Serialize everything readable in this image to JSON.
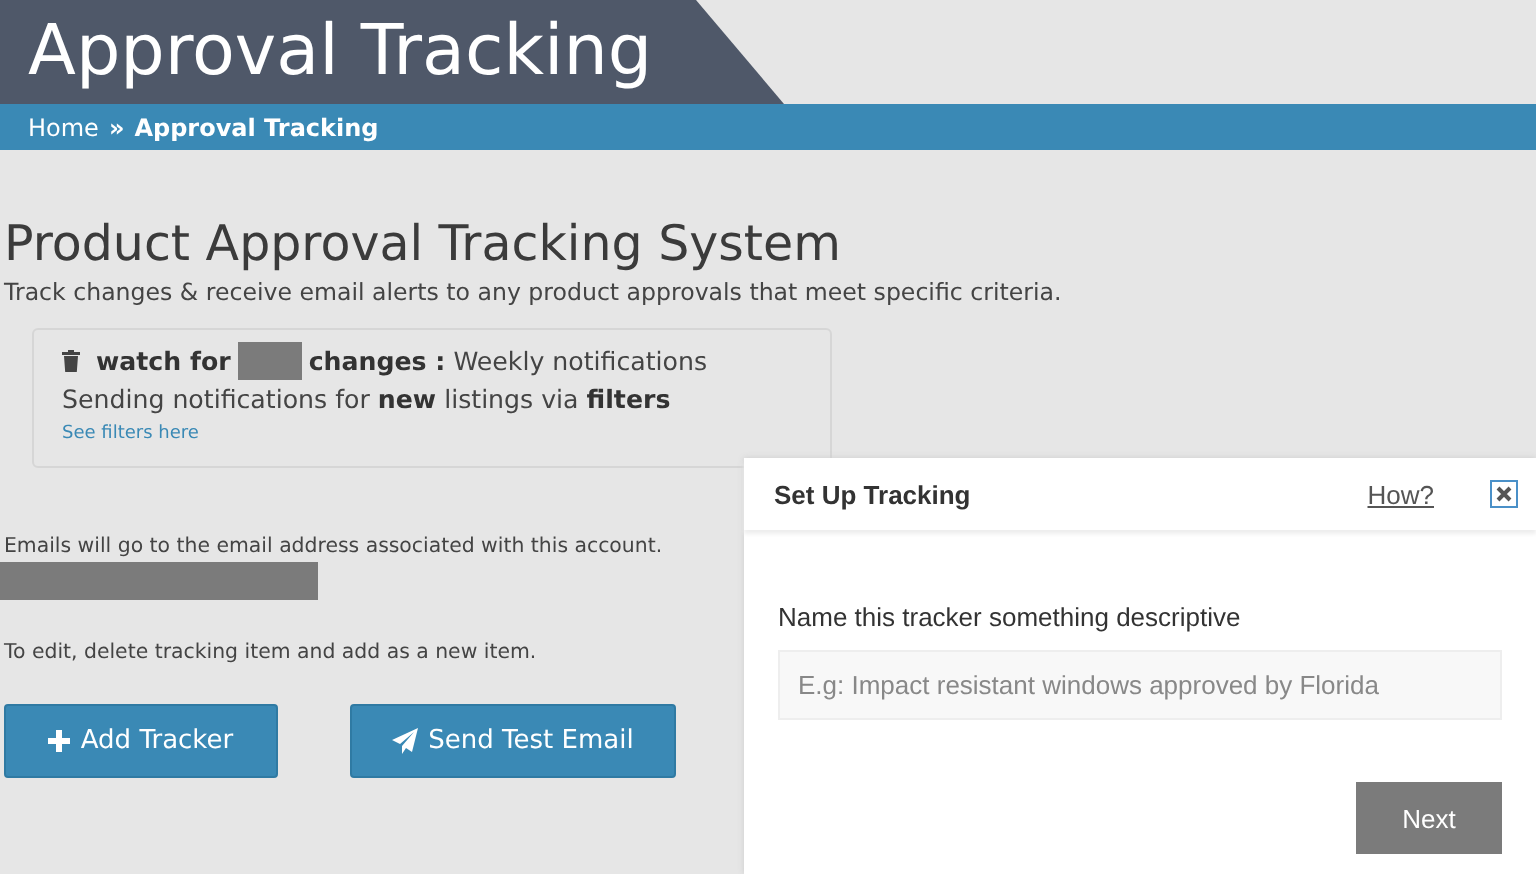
{
  "header": {
    "title": "Approval Tracking"
  },
  "breadcrumb": [
    {
      "label": "Home",
      "current": false
    },
    {
      "label": "»",
      "current": true
    },
    {
      "label": "Approval Tracking",
      "current": true
    }
  ],
  "page": {
    "title": "Product Approval Tracking System",
    "subtitle": "Track changes & receive email alerts to any product approvals that meet specific criteria."
  },
  "tracker": {
    "name_prefix": "watch for",
    "name_suffix": "changes :",
    "frequency": "Weekly notifications",
    "description": "Sending notifications for **new** listings via **filters**",
    "link": "See filters here"
  },
  "email_note": "Emails will go to the email address associated with this account.",
  "edit_note": "To edit, delete tracking item and add as a new item.",
  "buttons": [
    {
      "label": "Add Tracker",
      "kind": "plus"
    },
    {
      "label": "Send Test Email",
      "kind": "send"
    }
  ],
  "modal": {
    "title": "Set Up Tracking",
    "help_link": "How?",
    "field_label": "Name this tracker something descriptive",
    "placeholder": "E.g: Impact resistant windows approved by Florida",
    "next_button": "Next"
  }
}
